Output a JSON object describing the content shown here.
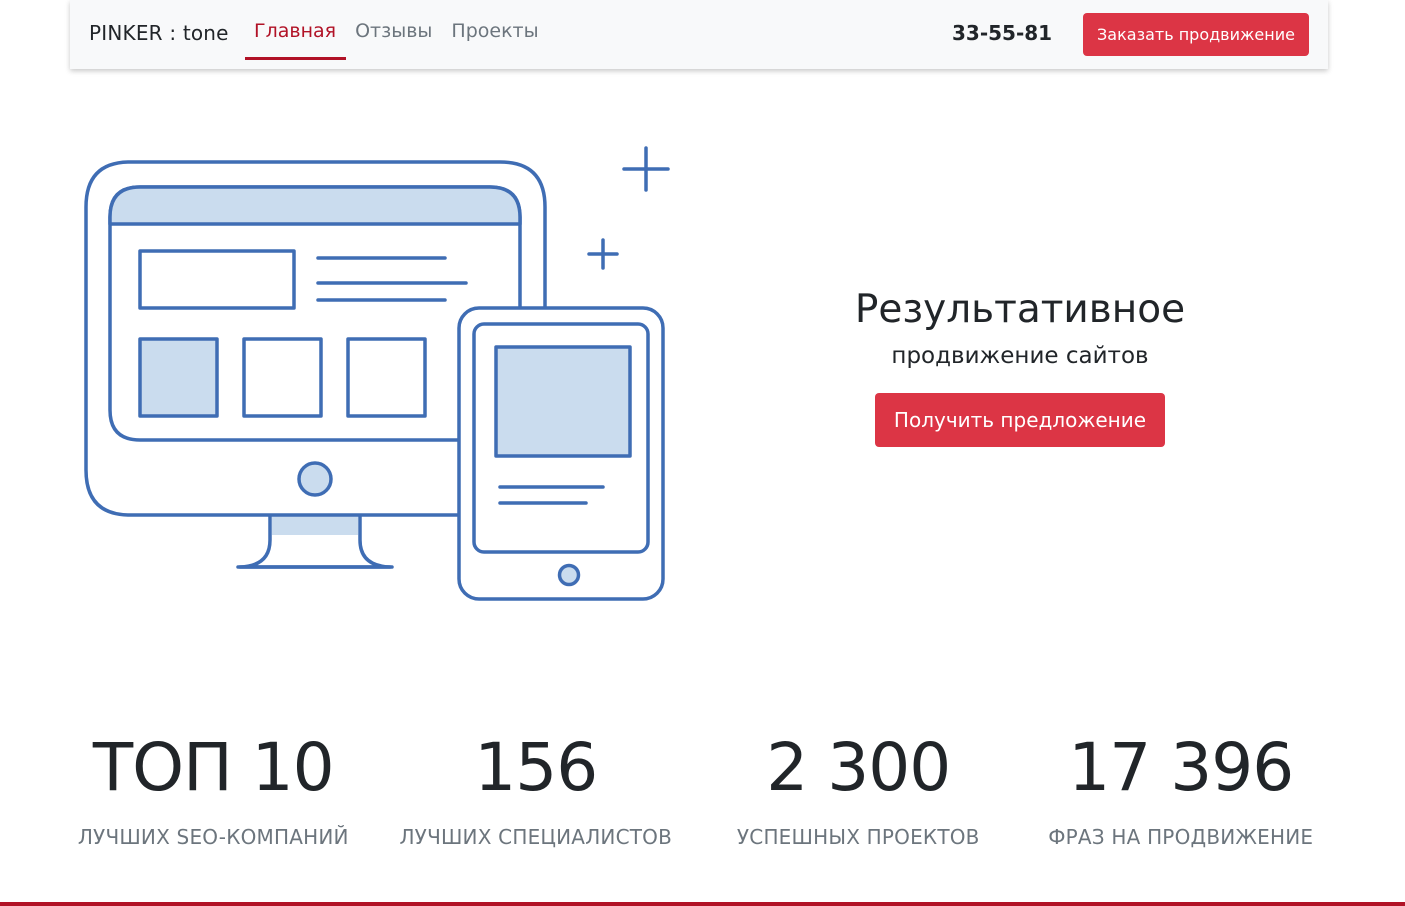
{
  "navbar": {
    "brand": "PINKER : tone",
    "links": [
      {
        "label": "Главная",
        "active": true
      },
      {
        "label": "Отзывы",
        "active": false
      },
      {
        "label": "Проекты",
        "active": false
      }
    ],
    "phone": "33-55-81",
    "cta_label": "Заказать продвижение"
  },
  "hero": {
    "illustration_icon": "devices-illustration-icon",
    "title": "Результативное",
    "subtitle": "продвижение сайтов",
    "cta_label": "Получить предложение"
  },
  "stats": [
    {
      "value": "ТОП 10",
      "label": "ЛУЧШИХ SEO-КОМПАНИЙ"
    },
    {
      "value": "156",
      "label": "ЛУЧШИХ СПЕЦИАЛИСТОВ"
    },
    {
      "value": "2 300",
      "label": "УСПЕШНЫХ ПРОЕКТОВ"
    },
    {
      "value": "17 396",
      "label": "ФРАЗ НА ПРОДВИЖЕНИЕ"
    }
  ],
  "colors": {
    "accent": "#dc3545",
    "active_link": "#b11226",
    "illustration_stroke": "#3f6db4",
    "illustration_fill": "#cadcee"
  }
}
